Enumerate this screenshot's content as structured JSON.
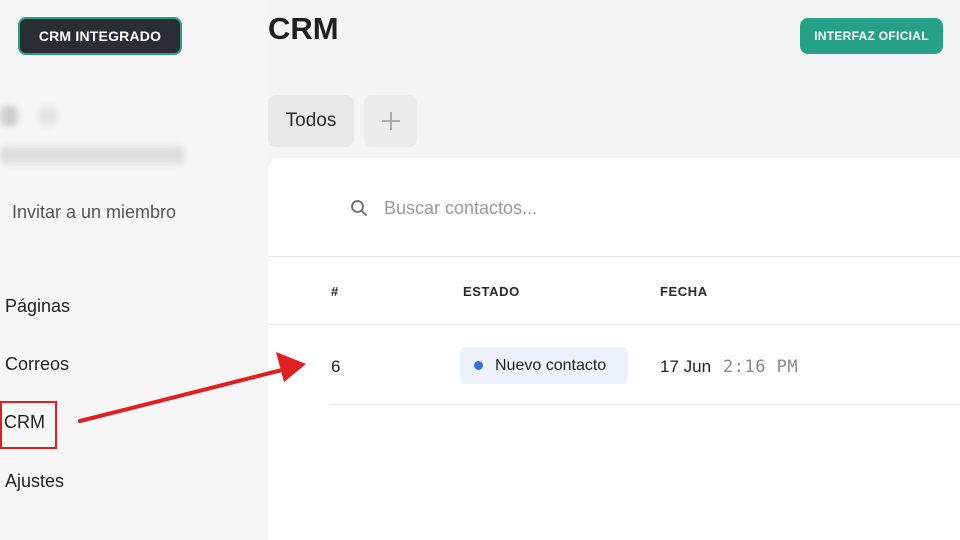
{
  "sidebar": {
    "badge_label": "CRM INTEGRADO",
    "invite_label": "Invitar a un miembro",
    "items": [
      {
        "label": "Páginas"
      },
      {
        "label": "Correos"
      },
      {
        "label": "CRM"
      },
      {
        "label": "Ajustes"
      }
    ]
  },
  "header": {
    "title": "CRM",
    "official_button": "INTERFAZ OFICIAL"
  },
  "tabs": [
    {
      "label": "Todos"
    },
    {
      "label": "+"
    }
  ],
  "search": {
    "placeholder": "Buscar contactos...",
    "value": ""
  },
  "table": {
    "columns": [
      "#",
      "ESTADO",
      "FECHA"
    ],
    "rows": [
      {
        "number": "6",
        "status": "Nuevo contacto",
        "date": "17 Jun",
        "time": "2:16 PM"
      }
    ]
  },
  "colors": {
    "accent": "#26a087",
    "badge_bg": "#2b2d35",
    "annotation": "#e02020",
    "status_dot": "#3f6fdb",
    "status_bg": "#ecf1fb"
  }
}
